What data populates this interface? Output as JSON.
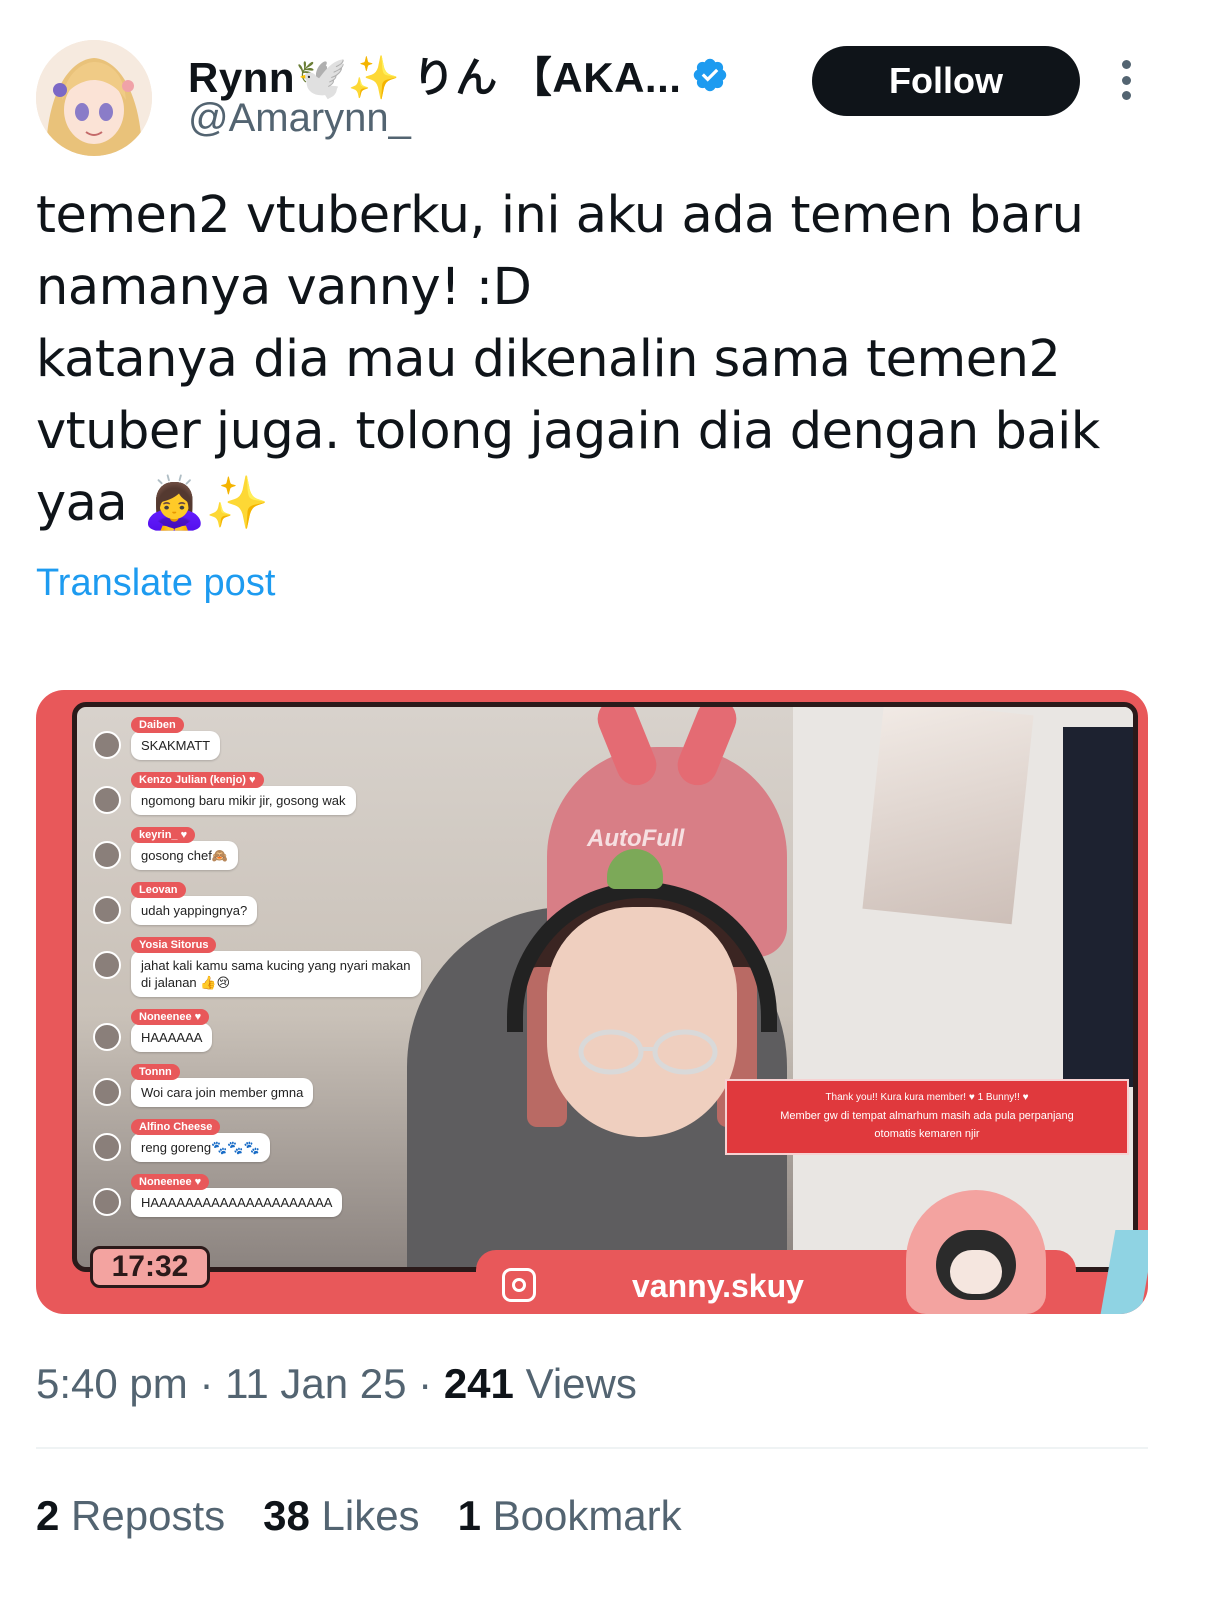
{
  "author": {
    "display_name": "Rynn🕊️✨ りん 【AKA...",
    "handle": "@Amarynn_",
    "verified": true,
    "follow_label": "Follow"
  },
  "post": {
    "text": "temen2 vtuberku, ini aku ada temen baru\nnamanya vanny! :D\nkatanya dia mau dikenalin sama temen2\nvtuber juga. tolong jagain dia dengan baik\nyaa 🙇‍♀️✨",
    "translate_label": "Translate post"
  },
  "media": {
    "chair_brand": "AutoFull",
    "timer": "17:32",
    "channel_name": "vanny.skuy",
    "member_alert_line1": "Thank you!! Kura kura member! ♥ 1 Bunny!! ♥",
    "member_alert_line2": "Member gw di tempat almarhum masih ada pula perpanjang",
    "member_alert_line3": "otomatis kemaren njir",
    "chat": [
      {
        "name": "Daiben",
        "message": "SKAKMATT"
      },
      {
        "name": "Kenzo Julian (kenjo) ♥",
        "message": "ngomong baru mikir jir, gosong wak"
      },
      {
        "name": "keyrin_ ♥",
        "message": "gosong chef🙈"
      },
      {
        "name": "Leovan",
        "message": "udah yappingnya?"
      },
      {
        "name": "Yosia Sitorus",
        "message": "jahat kali kamu sama kucing yang nyari makan di jalanan 👍😢"
      },
      {
        "name": "Noneenee ♥",
        "message": "HAAAAAA"
      },
      {
        "name": "Tonnn",
        "message": "Woi cara join member gmna"
      },
      {
        "name": "Alfino Cheese",
        "message": "reng goreng🐾🐾🐾"
      },
      {
        "name": "Noneenee ♥",
        "message": "HAAAAAAAAAAAAAAAAAAAAA"
      }
    ]
  },
  "meta": {
    "time": "5:40 pm",
    "separator": "·",
    "date": "11 Jan 25",
    "views_count": "241",
    "views_label": "Views"
  },
  "stats": {
    "reposts_count": "2",
    "reposts_label": "Reposts",
    "likes_count": "38",
    "likes_label": "Likes",
    "bookmarks_count": "1",
    "bookmarks_label": "Bookmark"
  },
  "colors": {
    "link": "#1d9bf0",
    "secondary_text": "#536471",
    "verified_badge": "#1d9bf0",
    "media_accent": "#e8585a"
  }
}
